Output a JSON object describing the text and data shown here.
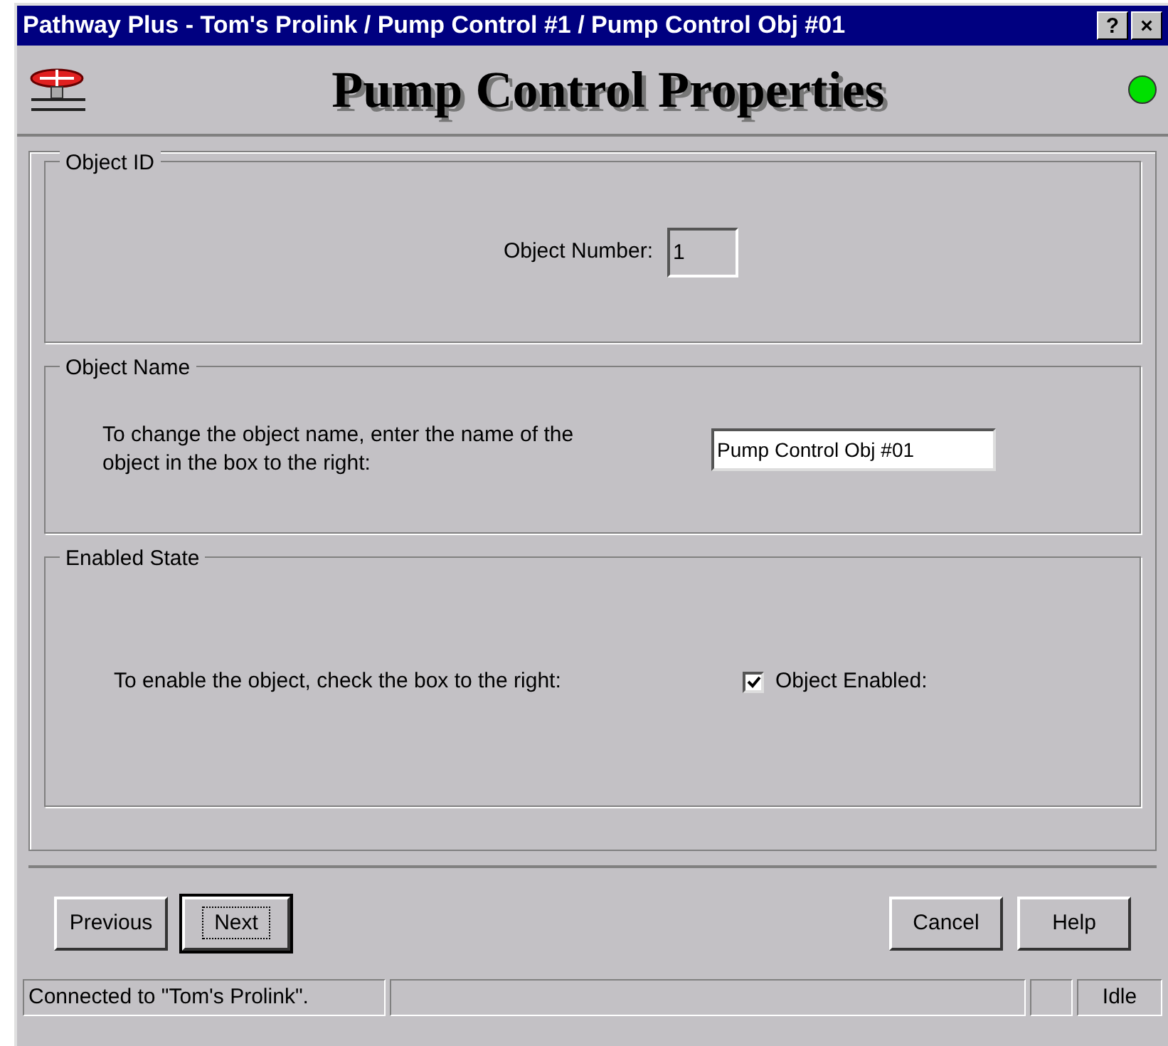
{
  "window": {
    "title": "Pathway Plus - Tom's Prolink / Pump Control #1 / Pump Control Obj #01",
    "buttons": [
      "?",
      "×"
    ]
  },
  "header": {
    "title": "Pump Control Properties",
    "status_light": {
      "color": "#00e000"
    }
  },
  "groups": [
    {
      "kind": "number",
      "title": "Object ID",
      "label": "Object Number:",
      "value": "1",
      "disabled": true
    },
    {
      "kind": "text",
      "title": "Object Name",
      "label": "To change the object name, enter the name of the object in the box to the right:",
      "value": "Pump Control Obj #01",
      "disabled": false
    },
    {
      "kind": "checkbox",
      "title": "Enabled State",
      "label": "To enable the object, check the box to the right:",
      "checkbox_label": "Object Enabled:",
      "checked": true
    }
  ],
  "nav_buttons": [
    {
      "label": "Previous",
      "focused": false
    },
    {
      "label": "Next",
      "focused": true
    }
  ],
  "action_buttons": [
    {
      "label": "Cancel",
      "focused": false
    },
    {
      "label": "Help",
      "focused": false
    }
  ],
  "status_bar": {
    "message": "Connected to \"Tom's Prolink\".",
    "state": "Idle"
  }
}
